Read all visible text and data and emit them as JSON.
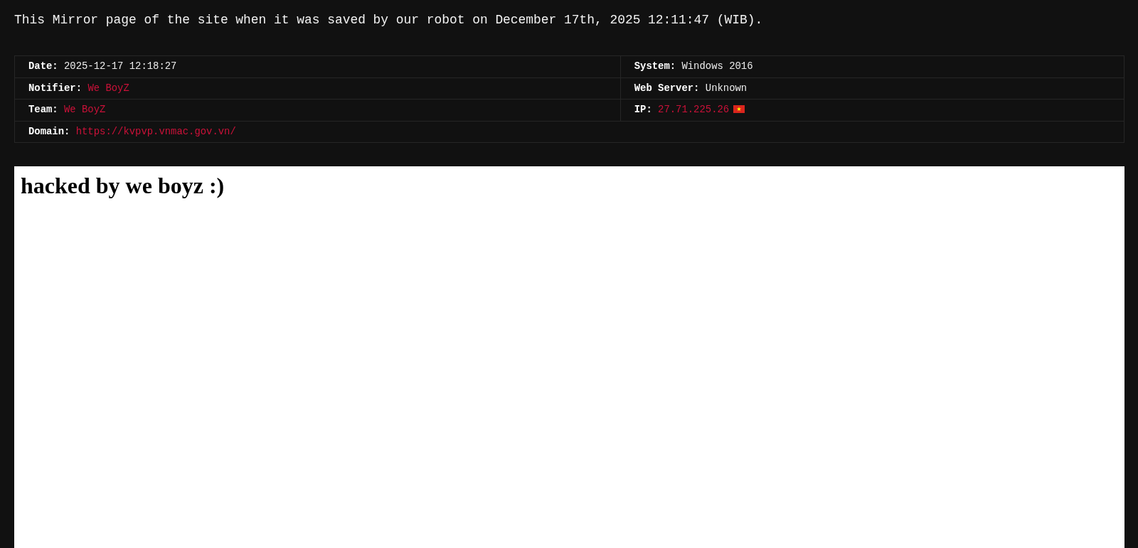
{
  "notice": "This Mirror page of the site when it was saved by our robot on December 17th, 2025 12:11:47 (WIB).",
  "info": {
    "rows": [
      {
        "cells": [
          {
            "label": "Date:",
            "value": "2025-12-17 12:18:27",
            "kind": "text"
          },
          {
            "label": "System:",
            "value": "Windows 2016",
            "kind": "text"
          }
        ]
      },
      {
        "cells": [
          {
            "label": "Notifier:",
            "value": "We BoyZ",
            "kind": "link"
          },
          {
            "label": "Web Server:",
            "value": "Unknown",
            "kind": "text"
          }
        ]
      },
      {
        "cells": [
          {
            "label": "Team:",
            "value": "We BoyZ",
            "kind": "link"
          },
          {
            "label": "IP:",
            "value": "27.71.225.26",
            "kind": "ip"
          }
        ]
      },
      {
        "cells": [
          {
            "label": "Domain:",
            "value": "https://kvpvp.vnmac.gov.vn/",
            "kind": "link",
            "colspan": 2
          }
        ]
      }
    ]
  },
  "mirror": {
    "heading": "hacked by we boyz :)"
  }
}
